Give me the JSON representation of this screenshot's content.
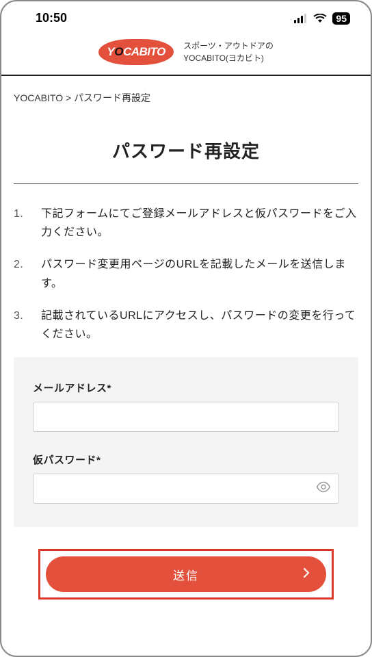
{
  "status": {
    "time": "10:50",
    "battery": "95"
  },
  "header": {
    "logo_text_y": "Y",
    "logo_text_o": "O",
    "logo_text_rest": "CABITO",
    "tagline_line1": "スポーツ・アウトドアの",
    "tagline_line2": "YOCABITO(ヨカビト)"
  },
  "breadcrumb": {
    "root": "YOCABITO",
    "sep": " > ",
    "current": "パスワード再設定"
  },
  "page_title": "パスワード再設定",
  "instructions": [
    "下記フォームにてご登録メールアドレスと仮パスワードをご入力ください。",
    "パスワード変更用ページのURLを記載したメールを送信します。",
    "記載されているURLにアクセスし、パスワードの変更を行ってください。"
  ],
  "form": {
    "email_label": "メールアドレス*",
    "password_label": "仮パスワード*",
    "submit_label": "送信"
  }
}
